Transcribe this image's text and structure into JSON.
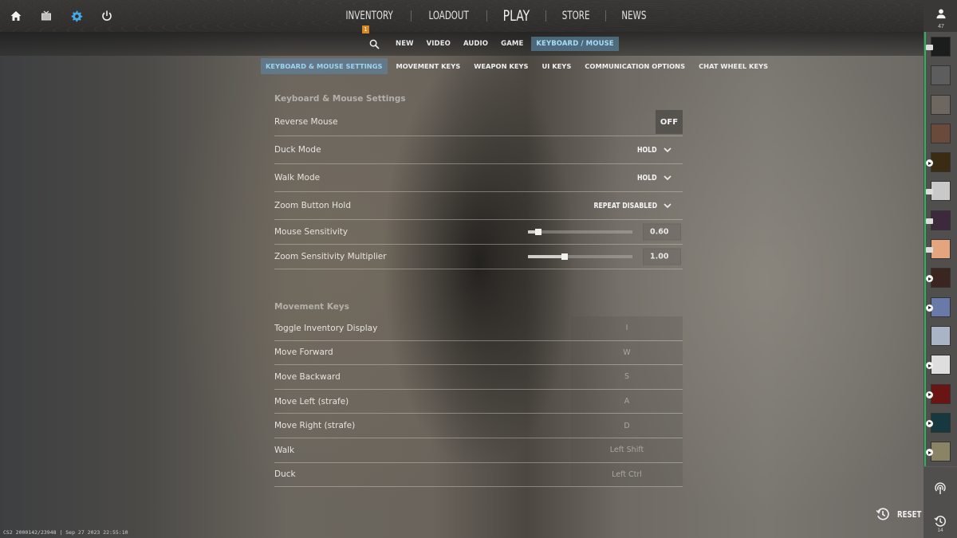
{
  "top_icons": [
    {
      "name": "home-icon"
    },
    {
      "name": "tv-icon"
    },
    {
      "name": "settings-icon",
      "active": true
    },
    {
      "name": "power-icon"
    }
  ],
  "main_nav": {
    "items": [
      {
        "label": "INVENTORY",
        "badge": "1"
      },
      {
        "label": "LOADOUT"
      },
      {
        "label": "PLAY"
      },
      {
        "label": "STORE"
      },
      {
        "label": "NEWS"
      }
    ]
  },
  "friends": {
    "count": "47"
  },
  "settings_nav": {
    "items": [
      "NEW",
      "VIDEO",
      "AUDIO",
      "GAME",
      "KEYBOARD / MOUSE"
    ],
    "active": "KEYBOARD / MOUSE"
  },
  "tabs": {
    "items": [
      "KEYBOARD & MOUSE SETTINGS",
      "MOVEMENT KEYS",
      "WEAPON KEYS",
      "UI KEYS",
      "COMMUNICATION OPTIONS",
      "CHAT WHEEL KEYS"
    ],
    "active": "KEYBOARD & MOUSE SETTINGS"
  },
  "kb_mouse_settings": {
    "title": "Keyboard & Mouse Settings",
    "reverse_mouse": {
      "label": "Reverse Mouse",
      "value": "OFF"
    },
    "duck_mode": {
      "label": "Duck Mode",
      "value": "HOLD"
    },
    "walk_mode": {
      "label": "Walk Mode",
      "value": "HOLD"
    },
    "zoom_button_hold": {
      "label": "Zoom Button Hold",
      "value": "REPEAT DISABLED"
    },
    "mouse_sensitivity": {
      "label": "Mouse Sensitivity",
      "value": "0.60",
      "slider_fraction": 0.1
    },
    "zoom_sensitivity": {
      "label": "Zoom Sensitivity Multiplier",
      "value": "1.00",
      "slider_fraction": 0.35
    }
  },
  "movement_keys": {
    "title": "Movement Keys",
    "rows": [
      {
        "label": "Toggle Inventory Display",
        "key": "I"
      },
      {
        "label": "Move Forward",
        "key": "W"
      },
      {
        "label": "Move Backward",
        "key": "S"
      },
      {
        "label": "Move Left (strafe)",
        "key": "A"
      },
      {
        "label": "Move Right (strafe)",
        "key": "D"
      },
      {
        "label": "Walk",
        "key": "Left Shift"
      },
      {
        "label": "Duck",
        "key": "Left Ctrl"
      }
    ]
  },
  "friends_list": [
    {
      "color": "#1b1d1c",
      "status": "chip"
    },
    {
      "color": "#5d5d5d",
      "status": "none"
    },
    {
      "color": "#6e675f",
      "status": "none"
    },
    {
      "color": "#6a4a3a",
      "status": "none"
    },
    {
      "color": "#3a2c12",
      "status": "play"
    },
    {
      "color": "#c9c9c9",
      "status": "chip"
    },
    {
      "color": "#3c2a3c",
      "status": "chip"
    },
    {
      "color": "#e4a57e",
      "status": "chip"
    },
    {
      "color": "#3a2520",
      "status": "play"
    },
    {
      "color": "#6a7aa8",
      "status": "play"
    },
    {
      "color": "#a9b4c6",
      "status": "none"
    },
    {
      "color": "#dedede",
      "status": "play"
    },
    {
      "color": "#6a1414",
      "status": "play"
    },
    {
      "color": "#15393f",
      "status": "play"
    },
    {
      "color": "#8a8366",
      "status": "play"
    }
  ],
  "sidebar_bottom": {
    "history_count": "14"
  },
  "reset": {
    "label": "RESET"
  },
  "build_info": "CS2 2000142/23948 | Sep 27 2023 22:55:10"
}
